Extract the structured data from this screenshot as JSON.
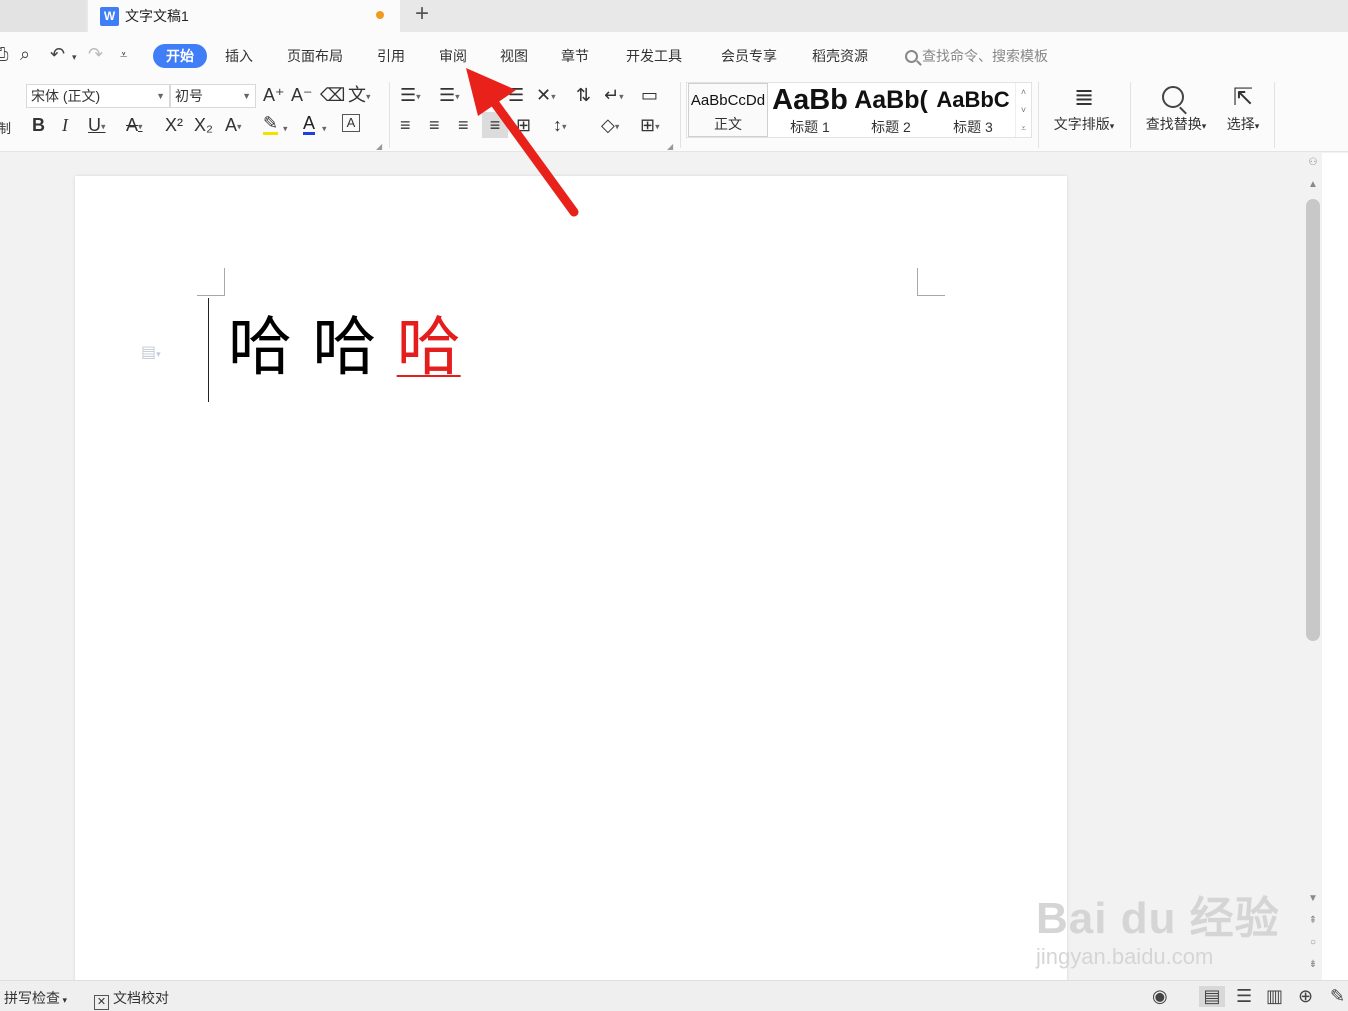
{
  "tab": {
    "doc_title": "文字文稿1",
    "wps_glyph": "W",
    "new_tab": "+"
  },
  "menu": {
    "items": [
      {
        "label": "开始",
        "active": true
      },
      {
        "label": "插入"
      },
      {
        "label": "页面布局"
      },
      {
        "label": "引用"
      },
      {
        "label": "审阅"
      },
      {
        "label": "视图"
      },
      {
        "label": "章节"
      },
      {
        "label": "开发工具"
      },
      {
        "label": "会员专享"
      },
      {
        "label": "稻壳资源"
      }
    ],
    "search_placeholder": "查找命令、搜索模板"
  },
  "ribbon": {
    "font_name": "宋体 (正文)",
    "font_size": "初号",
    "styles": [
      {
        "sample": "AaBbCcDd",
        "label": "正文"
      },
      {
        "sample": "AaBb",
        "label": "标题 1"
      },
      {
        "sample": "AaBb(",
        "label": "标题 2"
      },
      {
        "sample": "AaBbC",
        "label": "标题 3"
      }
    ],
    "text_layout": "文字排版",
    "find_replace": "查找替换",
    "select": "选择",
    "clip_label": "制"
  },
  "document": {
    "text_black": "哈 哈 ",
    "text_red": "哈",
    "colors": {
      "red_text": "#e41d1d",
      "accent": "#3f7ef7"
    }
  },
  "statusbar": {
    "spell_check": "拼写检查",
    "doc_proof": "文档校对"
  },
  "watermark": {
    "line1": "Bai du 经验",
    "line2": "jingyan.baidu.com"
  }
}
